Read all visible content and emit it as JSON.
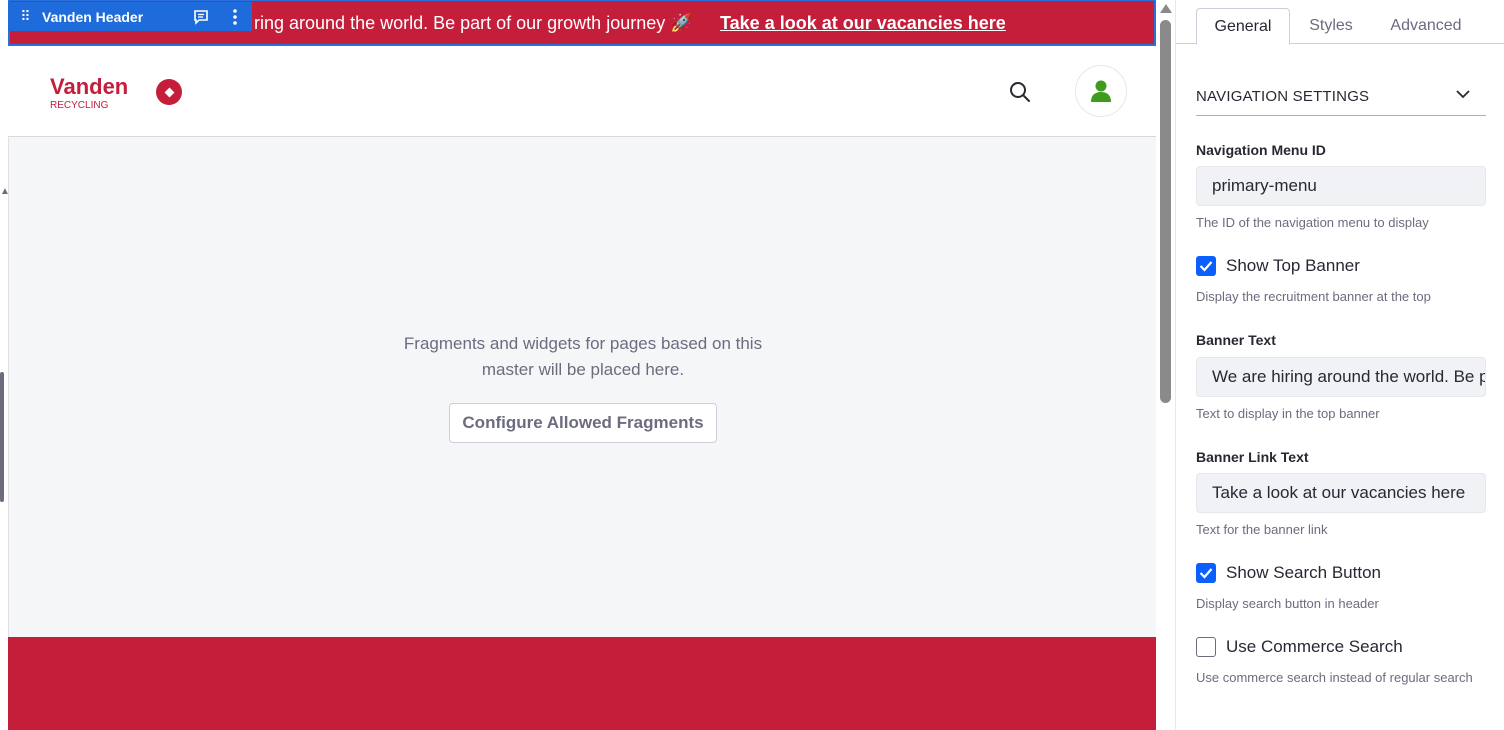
{
  "canvas": {
    "topper": {
      "name": "Vanden Header",
      "drag_icon": "drag-handle-icon",
      "comment_icon": "comment-icon",
      "menu_icon": "kebab-menu-icon"
    },
    "banner": {
      "text": "ring around the world. Be part of our growth journey 🚀",
      "link_text": "Take a look at our vacancies here",
      "background": "#c41e3a"
    },
    "header": {
      "logo_main": "Vanden",
      "logo_sub": "RECYCLING",
      "search_icon": "search-icon",
      "user_icon": "user-icon"
    },
    "dropzone": {
      "line1": "Fragments and widgets for pages based on this",
      "line2": "master will be placed here.",
      "button": "Configure Allowed Fragments"
    },
    "footer": {
      "background": "#c41e3a"
    }
  },
  "panel": {
    "tabs": [
      {
        "label": "General",
        "active": true
      },
      {
        "label": "Styles",
        "active": false
      },
      {
        "label": "Advanced",
        "active": false
      }
    ],
    "section_title": "NAVIGATION SETTINGS",
    "fields": {
      "menu_id": {
        "label": "Navigation Menu ID",
        "value": "primary-menu",
        "help": "The ID of the navigation menu to display"
      },
      "show_banner": {
        "label": "Show Top Banner",
        "checked": true,
        "help": "Display the recruitment banner at the top"
      },
      "banner_text": {
        "label": "Banner Text",
        "value": "We are hiring around the world. Be part of our growth journey",
        "help": "Text to display in the top banner"
      },
      "banner_link_text": {
        "label": "Banner Link Text",
        "value": "Take a look at our vacancies here",
        "help": "Text for the banner link"
      },
      "show_search": {
        "label": "Show Search Button",
        "checked": true,
        "help": "Display search button in header"
      },
      "commerce_search": {
        "label": "Use Commerce Search",
        "checked": false,
        "help": "Use commerce search instead of regular search"
      }
    }
  },
  "colors": {
    "brand": "#c41e3a",
    "accent": "#0b5fff",
    "topper": "#1e6bdb"
  }
}
